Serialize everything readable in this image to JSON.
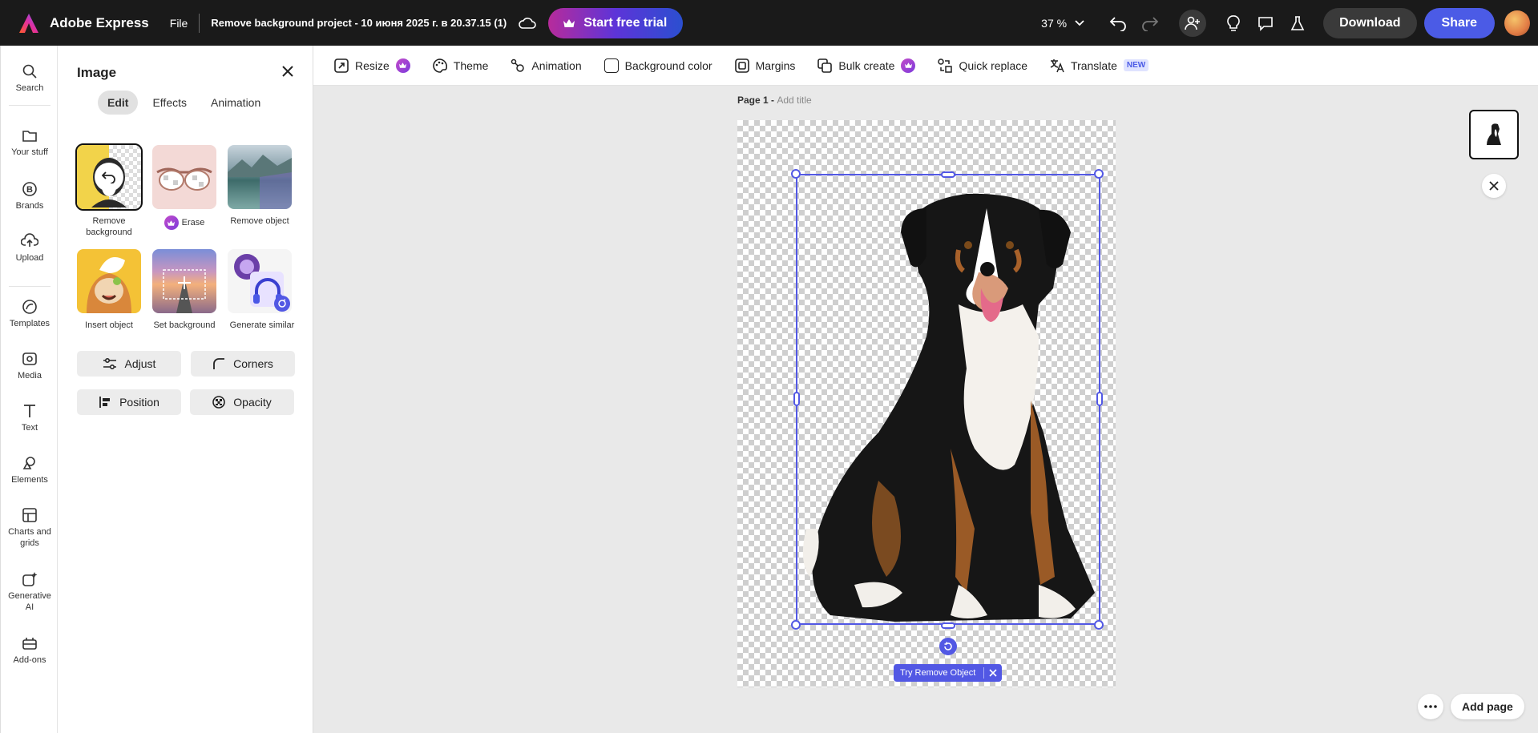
{
  "header": {
    "app_name": "Adobe Express",
    "file_menu": "File",
    "document_title": "Remove background project - 10 июня 2025 г. в 20.37.15 (1)",
    "trial_button": "Start free trial",
    "zoom": "37 %",
    "download_button": "Download",
    "share_button": "Share"
  },
  "rail": {
    "items": [
      {
        "label": "Search",
        "icon": "search-icon"
      },
      {
        "label": "Your stuff",
        "icon": "folder-icon"
      },
      {
        "label": "Brands",
        "icon": "brand-icon"
      },
      {
        "label": "Upload",
        "icon": "upload-icon"
      },
      {
        "label": "Templates",
        "icon": "templates-icon"
      },
      {
        "label": "Media",
        "icon": "media-icon"
      },
      {
        "label": "Text",
        "icon": "text-icon"
      },
      {
        "label": "Elements",
        "icon": "elements-icon"
      },
      {
        "label": "Charts and grids",
        "icon": "charts-icon"
      },
      {
        "label": "Generative AI",
        "icon": "generative-ai-icon"
      },
      {
        "label": "Add-ons",
        "icon": "addons-icon"
      }
    ]
  },
  "panel": {
    "title": "Image",
    "tabs": [
      "Edit",
      "Effects",
      "Animation"
    ],
    "active_tab": "Edit",
    "tools": [
      {
        "label": "Remove background"
      },
      {
        "label": "Erase"
      },
      {
        "label": "Remove object"
      },
      {
        "label": "Insert object"
      },
      {
        "label": "Set background"
      },
      {
        "label": "Generate similar"
      }
    ],
    "buttons": {
      "adjust": "Adjust",
      "corners": "Corners",
      "position": "Position",
      "opacity": "Opacity"
    }
  },
  "toolbar": {
    "resize": "Resize",
    "theme": "Theme",
    "animation": "Animation",
    "background_color": "Background color",
    "margins": "Margins",
    "bulk_create": "Bulk create",
    "quick_replace": "Quick replace",
    "translate": "Translate",
    "new_badge": "NEW"
  },
  "canvas": {
    "page_label": "Page 1 - ",
    "add_title": "Add title",
    "try_remove_object": "Try Remove Object"
  },
  "footer": {
    "add_page": "Add page"
  },
  "colors": {
    "accent": "#5258e4",
    "share": "#4b5be6",
    "topbar": "#1a1a1a"
  }
}
